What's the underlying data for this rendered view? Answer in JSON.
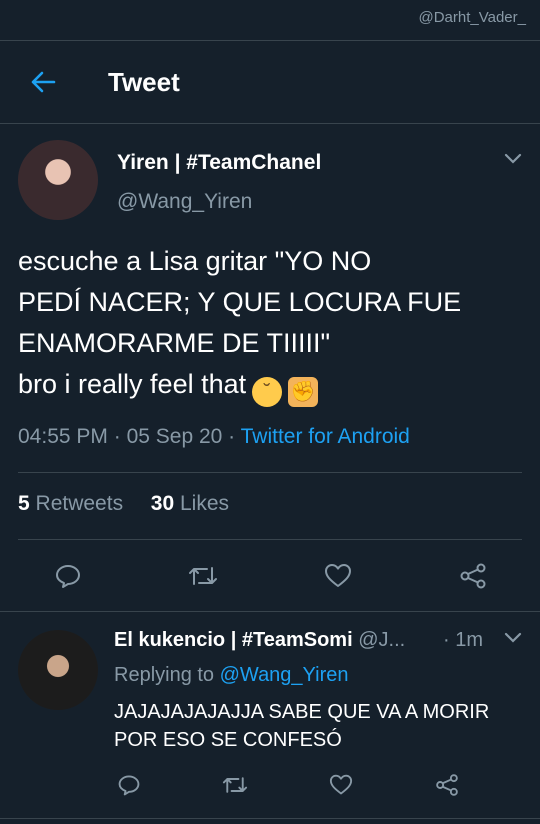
{
  "watermark": "@Darht_Vader_",
  "topbar": {
    "title": "Tweet"
  },
  "tweet": {
    "author_name": "Yiren | #TeamChanel",
    "author_handle": "@Wang_Yiren",
    "text_lines": [
      "escuche a Lisa gritar \"YO NO",
      "PEDÍ NACER; Y QUE LOCURA FUE",
      "ENAMORARME DE TIIIII\"",
      "bro i really feel that"
    ],
    "emojis": [
      "pensive-face",
      "oncoming-fist"
    ],
    "time": "04:55 PM",
    "date": "05 Sep 20",
    "source": "Twitter for Android",
    "retweets_count": "5",
    "retweets_label": "Retweets",
    "likes_count": "30",
    "likes_label": "Likes"
  },
  "reply": {
    "author_name": "El kukencio | #TeamSomi",
    "author_handle": "@J...",
    "time": "1m",
    "replying_prefix": "Replying to",
    "replying_to": "@Wang_Yiren",
    "text": "JAJAJAJAJAJJA SABE QUE VA A MORIR POR ESO SE CONFESÓ"
  },
  "colors": {
    "background": "#15202b",
    "accent": "#1da1f2",
    "muted": "#8899a6",
    "divider": "#38444d"
  }
}
